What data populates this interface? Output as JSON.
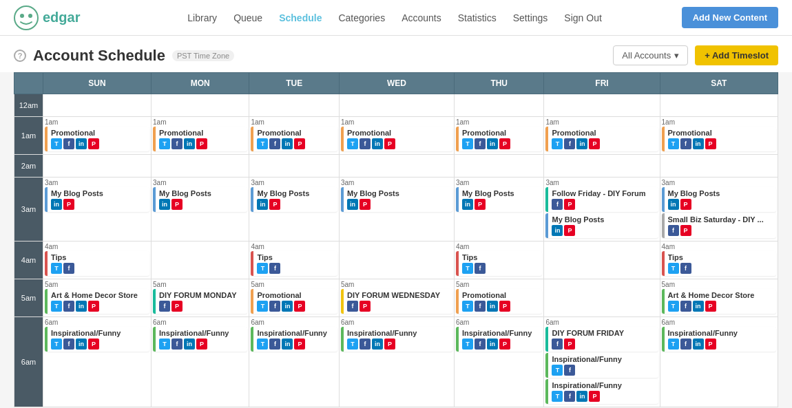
{
  "app": {
    "logo_text": "edgar",
    "nav_links": [
      {
        "label": "Library",
        "active": false
      },
      {
        "label": "Queue",
        "active": false
      },
      {
        "label": "Schedule",
        "active": true
      },
      {
        "label": "Categories",
        "active": false
      },
      {
        "label": "Accounts",
        "active": false
      },
      {
        "label": "Statistics",
        "active": false
      },
      {
        "label": "Settings",
        "active": false
      },
      {
        "label": "Sign Out",
        "active": false
      }
    ],
    "add_content_btn": "Add New Content"
  },
  "page": {
    "title": "Account Schedule",
    "timezone": "PST Time Zone",
    "accounts_btn": "All Accounts",
    "add_timeslot_btn": "+ Add Timeslot"
  },
  "calendar": {
    "days": [
      "SUN",
      "MON",
      "TUE",
      "WED",
      "THU",
      "FRI",
      "SAT"
    ],
    "time_labels": [
      "12am",
      "1am",
      "2am",
      "3am",
      "4am",
      "5am",
      "6am"
    ],
    "slots": {
      "1am": {
        "SUN": [
          {
            "title": "Promotional",
            "color": "orange",
            "icons": [
              "twitter",
              "facebook",
              "linkedin",
              "pinterest"
            ]
          }
        ],
        "MON": [
          {
            "title": "Promotional",
            "color": "orange",
            "icons": [
              "twitter",
              "facebook",
              "linkedin",
              "pinterest"
            ]
          }
        ],
        "TUE": [
          {
            "title": "Promotional",
            "color": "orange",
            "icons": [
              "twitter",
              "facebook",
              "linkedin",
              "pinterest"
            ]
          }
        ],
        "WED": [
          {
            "title": "Promotional",
            "color": "orange",
            "icons": [
              "twitter",
              "facebook",
              "linkedin",
              "pinterest"
            ]
          }
        ],
        "THU": [
          {
            "title": "Promotional",
            "color": "orange",
            "icons": [
              "twitter",
              "facebook",
              "linkedin",
              "pinterest"
            ]
          }
        ],
        "FRI": [
          {
            "title": "Promotional",
            "color": "orange",
            "icons": [
              "twitter",
              "facebook",
              "linkedin",
              "pinterest"
            ]
          }
        ],
        "SAT": [
          {
            "title": "Promotional",
            "color": "orange",
            "icons": [
              "twitter",
              "facebook",
              "linkedin",
              "pinterest"
            ]
          }
        ]
      },
      "3am": {
        "SUN": [
          {
            "title": "My Blog Posts",
            "color": "blue",
            "icons": [
              "linkedin",
              "pinterest"
            ]
          }
        ],
        "MON": [
          {
            "title": "My Blog Posts",
            "color": "blue",
            "icons": [
              "linkedin",
              "pinterest"
            ]
          }
        ],
        "TUE": [
          {
            "title": "My Blog Posts",
            "color": "blue",
            "icons": [
              "linkedin",
              "pinterest"
            ]
          }
        ],
        "WED": [
          {
            "title": "My Blog Posts",
            "color": "blue",
            "icons": [
              "linkedin",
              "pinterest"
            ]
          }
        ],
        "THU": [
          {
            "title": "My Blog Posts",
            "color": "blue",
            "icons": [
              "linkedin",
              "pinterest"
            ]
          }
        ],
        "FRI": [
          {
            "title": "Follow Friday - DIY Forum",
            "color": "teal",
            "icons": [
              "facebook",
              "pinterest"
            ]
          },
          {
            "title": "My Blog Posts",
            "color": "blue",
            "icons": [
              "linkedin",
              "pinterest"
            ]
          }
        ],
        "SAT": [
          {
            "title": "My Blog Posts",
            "color": "blue",
            "icons": [
              "linkedin",
              "pinterest"
            ]
          },
          {
            "title": "Small Biz Saturday - DIY ...",
            "color": "gray",
            "icons": [
              "facebook",
              "pinterest"
            ]
          }
        ]
      },
      "4am": {
        "SUN": [
          {
            "title": "Tips",
            "color": "red",
            "icons": [
              "twitter",
              "facebook"
            ]
          }
        ],
        "MON": [],
        "TUE": [
          {
            "title": "Tips",
            "color": "red",
            "icons": [
              "twitter",
              "facebook"
            ]
          }
        ],
        "WED": [],
        "THU": [
          {
            "title": "Tips",
            "color": "red",
            "icons": [
              "twitter",
              "facebook"
            ]
          }
        ],
        "FRI": [],
        "SAT": [
          {
            "title": "Tips",
            "color": "red",
            "icons": [
              "twitter",
              "facebook"
            ]
          }
        ]
      },
      "5am": {
        "SUN": [
          {
            "title": "Art & Home Decor Store",
            "color": "green",
            "icons": [
              "twitter",
              "facebook",
              "linkedin",
              "pinterest"
            ]
          }
        ],
        "MON": [
          {
            "title": "DIY FORUM MONDAY",
            "color": "teal",
            "icons": [
              "facebook",
              "pinterest"
            ]
          }
        ],
        "TUE": [
          {
            "title": "Promotional",
            "color": "orange",
            "icons": [
              "twitter",
              "facebook",
              "linkedin",
              "pinterest"
            ]
          }
        ],
        "WED": [
          {
            "title": "DIY FORUM WEDNESDAY",
            "color": "yellow",
            "icons": [
              "facebook",
              "pinterest"
            ]
          }
        ],
        "THU": [
          {
            "title": "Promotional",
            "color": "orange",
            "icons": [
              "twitter",
              "facebook",
              "linkedin",
              "pinterest"
            ]
          }
        ],
        "FRI": [],
        "SAT": [
          {
            "title": "Art & Home Decor Store",
            "color": "green",
            "icons": [
              "twitter",
              "facebook",
              "linkedin",
              "pinterest"
            ]
          }
        ]
      },
      "6am": {
        "SUN": [
          {
            "title": "Inspirational/Funny",
            "color": "green",
            "icons": [
              "twitter",
              "facebook",
              "linkedin",
              "pinterest"
            ]
          }
        ],
        "MON": [
          {
            "title": "Inspirational/Funny",
            "color": "green",
            "icons": [
              "twitter",
              "facebook",
              "linkedin",
              "pinterest"
            ]
          }
        ],
        "TUE": [
          {
            "title": "Inspirational/Funny",
            "color": "green",
            "icons": [
              "twitter",
              "facebook",
              "linkedin",
              "pinterest"
            ]
          }
        ],
        "WED": [
          {
            "title": "Inspirational/Funny",
            "color": "green",
            "icons": [
              "twitter",
              "facebook",
              "linkedin",
              "pinterest"
            ]
          }
        ],
        "THU": [
          {
            "title": "Inspirational/Funny",
            "color": "green",
            "icons": [
              "twitter",
              "facebook",
              "linkedin",
              "pinterest"
            ]
          }
        ],
        "FRI": [
          {
            "title": "DIY FORUM FRIDAY",
            "color": "teal",
            "icons": [
              "facebook",
              "pinterest"
            ]
          },
          {
            "title": "Inspirational/Funny",
            "color": "green",
            "icons": [
              "twitter",
              "facebook"
            ]
          },
          {
            "title": "Inspirational/Funny",
            "color": "green",
            "icons": [
              "twitter",
              "facebook",
              "linkedin",
              "pinterest"
            ]
          }
        ],
        "SAT": [
          {
            "title": "Inspirational/Funny",
            "color": "green",
            "icons": [
              "twitter",
              "facebook",
              "linkedin",
              "pinterest"
            ]
          }
        ]
      }
    }
  }
}
